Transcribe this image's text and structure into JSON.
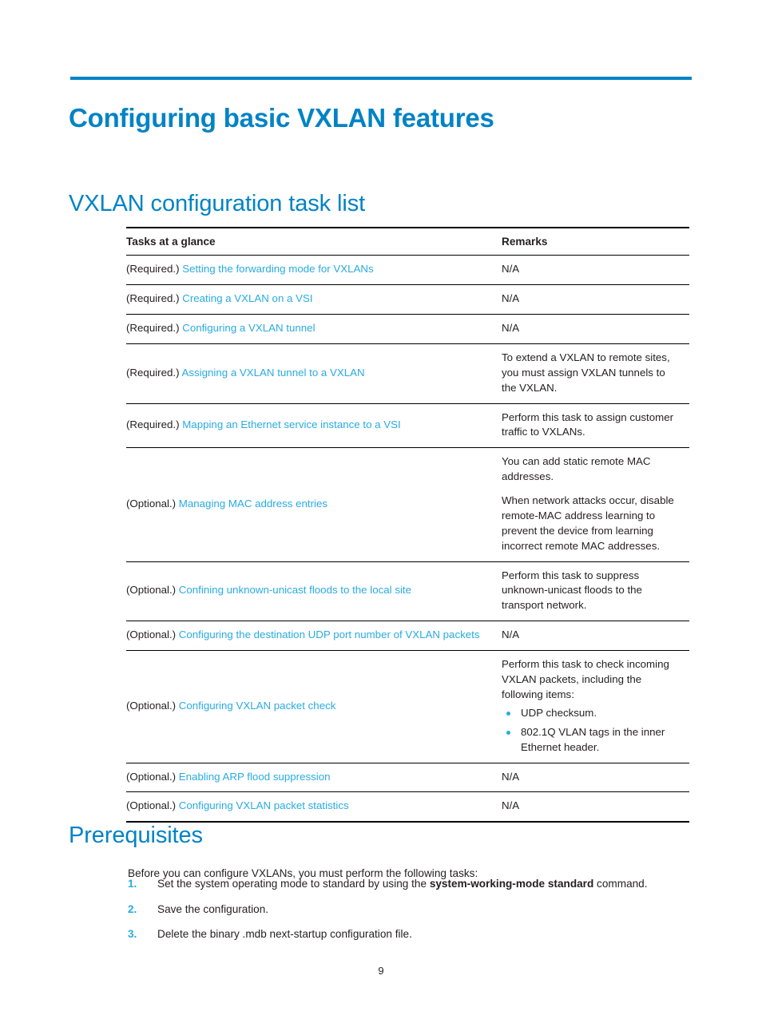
{
  "page": {
    "title": "Configuring basic VXLAN features",
    "page_number": "9",
    "accent_color": "#0083C4",
    "link_color": "#29ABE2",
    "text_color": "#231F20"
  },
  "sections": {
    "task_list": {
      "heading": "VXLAN configuration task list",
      "table": {
        "headers": [
          "Tasks at a glance",
          "Remarks"
        ],
        "rows": [
          {
            "requirement": "(Required.)",
            "link": "Setting the forwarding mode for VXLANs",
            "remarks": [
              "N/A"
            ]
          },
          {
            "requirement": "(Required.)",
            "link": "Creating a VXLAN on a VSI",
            "remarks": [
              "N/A"
            ]
          },
          {
            "requirement": "(Required.)",
            "link": "Configuring a VXLAN tunnel",
            "remarks": [
              "N/A"
            ]
          },
          {
            "requirement": "(Required.)",
            "link": "Assigning a VXLAN tunnel to a VXLAN",
            "remarks": [
              "To extend a VXLAN to remote sites, you must assign VXLAN tunnels to the VXLAN."
            ]
          },
          {
            "requirement": "(Required.)",
            "link": "Mapping an Ethernet service instance to a VSI",
            "remarks": [
              "Perform this task to assign customer traffic to VXLANs."
            ]
          },
          {
            "requirement": "(Optional.)",
            "link": "Managing MAC address entries",
            "remarks": [
              "You can add static remote MAC addresses.",
              "When network attacks occur, disable remote-MAC address learning to prevent the device from learning incorrect remote MAC addresses."
            ]
          },
          {
            "requirement": "(Optional.)",
            "link": "Confining unknown-unicast floods to the local site",
            "remarks": [
              "Perform this task to suppress unknown-unicast floods to the transport network."
            ]
          },
          {
            "requirement": "(Optional.)",
            "link": "Configuring the destination UDP port number of VXLAN packets",
            "remarks": [
              "N/A"
            ]
          },
          {
            "requirement": "(Optional.)",
            "link": "Configuring VXLAN packet check",
            "remarks": [
              "Perform this task to check incoming VXLAN packets, including the following items:"
            ],
            "bullets": [
              "UDP checksum.",
              "802.1Q VLAN tags in the inner Ethernet header."
            ]
          },
          {
            "requirement": "(Optional.)",
            "link": "Enabling ARP flood suppression",
            "remarks": [
              "N/A"
            ]
          },
          {
            "requirement": "(Optional.)",
            "link": "Configuring VXLAN packet statistics",
            "remarks": [
              "N/A"
            ]
          }
        ]
      }
    },
    "prerequisites": {
      "heading": "Prerequisites",
      "intro": "Before you can configure VXLANs, you must perform the following tasks:",
      "steps": [
        {
          "number": "1.",
          "text_before": "Set the system operating mode to standard by using the ",
          "bold": "system-working-mode standard",
          "text_after": " command."
        },
        {
          "number": "2.",
          "text_before": "Save the configuration.",
          "bold": "",
          "text_after": ""
        },
        {
          "number": "3.",
          "text_before": "Delete the binary .mdb next-startup configuration file.",
          "bold": "",
          "text_after": ""
        }
      ]
    }
  }
}
